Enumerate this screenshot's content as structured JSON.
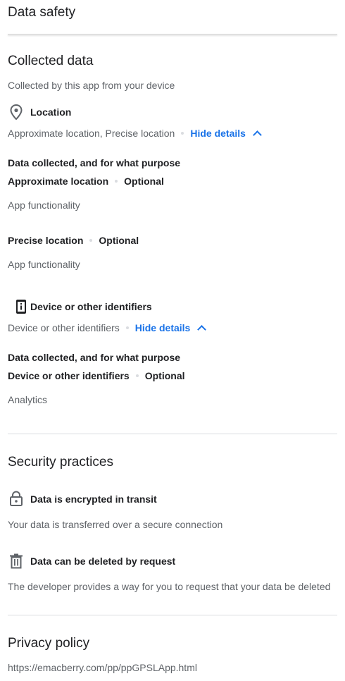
{
  "header": {
    "title": "Data safety"
  },
  "collected": {
    "title": "Collected data",
    "subtitle": "Collected by this app from your device",
    "location": {
      "title": "Location",
      "summary": "Approximate location, Precise location",
      "hide_link": "Hide details",
      "purpose_heading": "Data collected, and for what purpose",
      "items": [
        {
          "name": "Approximate location",
          "flag": "Optional",
          "purpose": "App functionality"
        },
        {
          "name": "Precise location",
          "flag": "Optional",
          "purpose": "App functionality"
        }
      ]
    },
    "identifiers": {
      "title": "Device or other identifiers",
      "summary": "Device or other identifiers",
      "hide_link": "Hide details",
      "purpose_heading": "Data collected, and for what purpose",
      "items": [
        {
          "name": "Device or other identifiers",
          "flag": "Optional",
          "purpose": "Analytics"
        }
      ]
    }
  },
  "security": {
    "title": "Security practices",
    "items": [
      {
        "title": "Data is encrypted in transit",
        "desc": "Your data is transferred over a secure connection"
      },
      {
        "title": "Data can be deleted by request",
        "desc": "The developer provides a way for you to request that your data be deleted"
      }
    ]
  },
  "privacy": {
    "title": "Privacy policy",
    "url": "https://emacberry.com/pp/ppGPSLApp.html"
  },
  "icons": {
    "location": "location-pin-icon",
    "identifiers": "phone-info-icon",
    "lock": "lock-icon",
    "trash": "trash-icon",
    "chevron": "chevron-up-icon"
  },
  "colors": {
    "link": "#1a73e8",
    "text": "#202124",
    "secondary": "#5f6368"
  }
}
